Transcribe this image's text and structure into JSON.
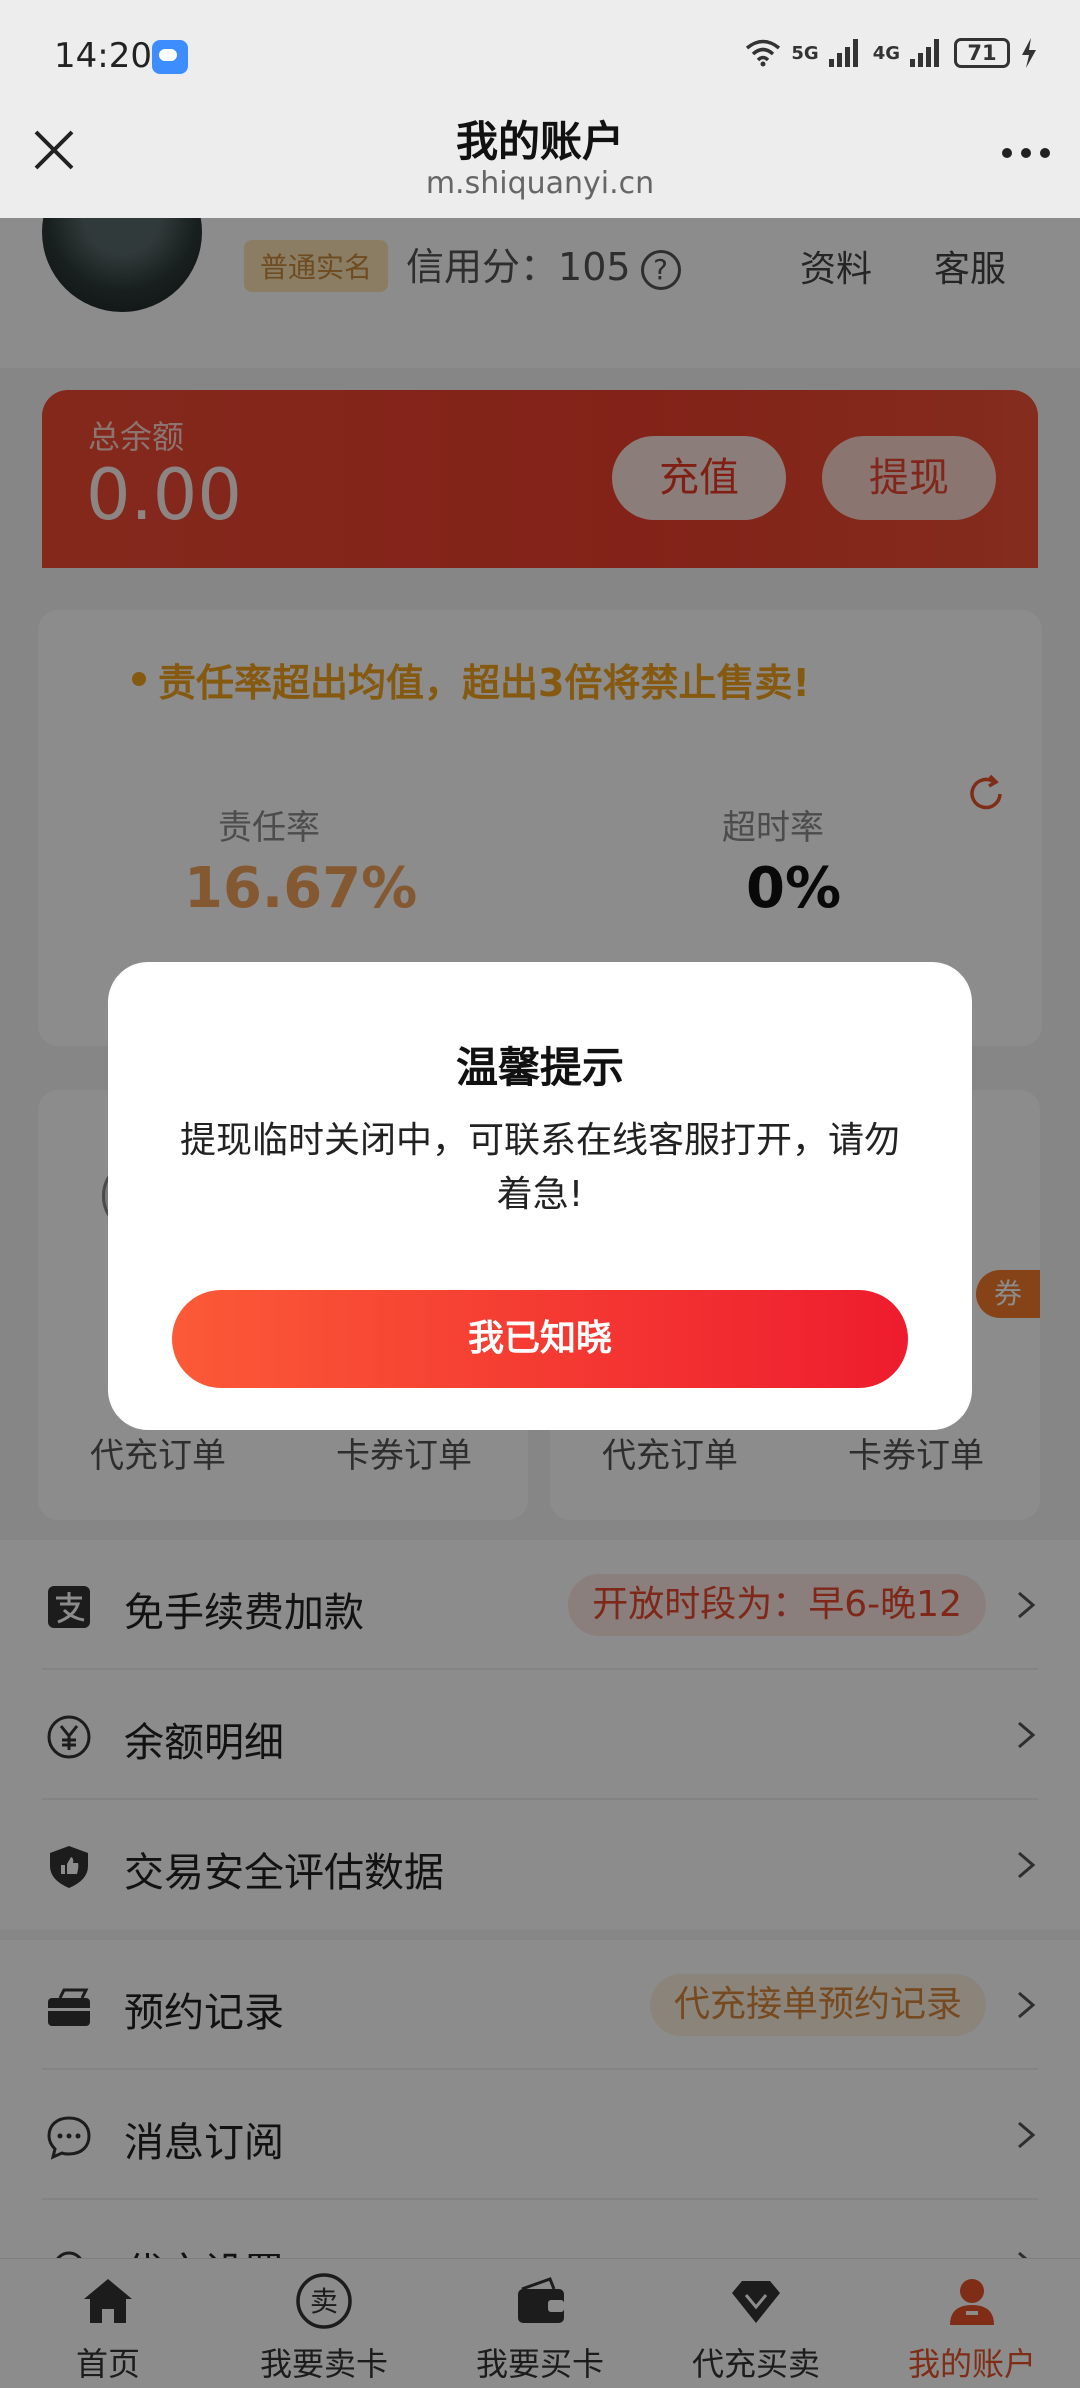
{
  "status_bar": {
    "time": "14:20",
    "network_1": "5G",
    "network_2": "4G",
    "battery": "71"
  },
  "title_bar": {
    "title": "我的账户",
    "url": "m.shiquanyi.cn"
  },
  "profile": {
    "badge": "普通实名",
    "credit_label": "信用分：",
    "credit_value": "105",
    "help": "?",
    "link_profile": "资料",
    "link_service": "客服"
  },
  "balance": {
    "label": "总余额",
    "value": "0.00",
    "recharge_label": "充值",
    "withdraw_label": "提现"
  },
  "stats": {
    "warning": "责任率超出均值，超出3倍将禁止售卖!",
    "responsibility_label": "责任率",
    "responsibility_value": "16.67%",
    "timeout_label": "超时率",
    "timeout_value": "0%"
  },
  "orders": {
    "left": {
      "recharge_orders": "代充订单",
      "coupon_orders": "卡券订单"
    },
    "right": {
      "recharge_orders": "代充订单",
      "coupon_orders": "卡券订单",
      "badge": "券"
    }
  },
  "menu_group_1": [
    {
      "label": "免手续费加款",
      "tag": "开放时段为：早6-晚12"
    },
    {
      "label": "余额明细"
    },
    {
      "label": "交易安全评估数据"
    }
  ],
  "menu_group_2": [
    {
      "label": "预约记录",
      "tag": "代充接单预约记录"
    },
    {
      "label": "消息订阅"
    },
    {
      "label": "代充设置"
    }
  ],
  "tabs": [
    {
      "label": "首页",
      "icon": "home-icon"
    },
    {
      "label": "我要卖卡",
      "icon": "sell-icon"
    },
    {
      "label": "我要买卡",
      "icon": "wallet-icon"
    },
    {
      "label": "代充买卖",
      "icon": "diamond-icon"
    },
    {
      "label": "我的账户",
      "icon": "user-icon"
    }
  ],
  "dialog": {
    "title": "温馨提示",
    "body": "提现临时关闭中，可联系在线客服打开，请勿着急!",
    "button": "我已知晓"
  },
  "colors": {
    "accent": "#ef3f2d",
    "warning": "#f2a21d",
    "dialog_button_start": "#fb5a37",
    "dialog_button_end": "#ee1c2e",
    "tab_active": "#e8532a"
  }
}
